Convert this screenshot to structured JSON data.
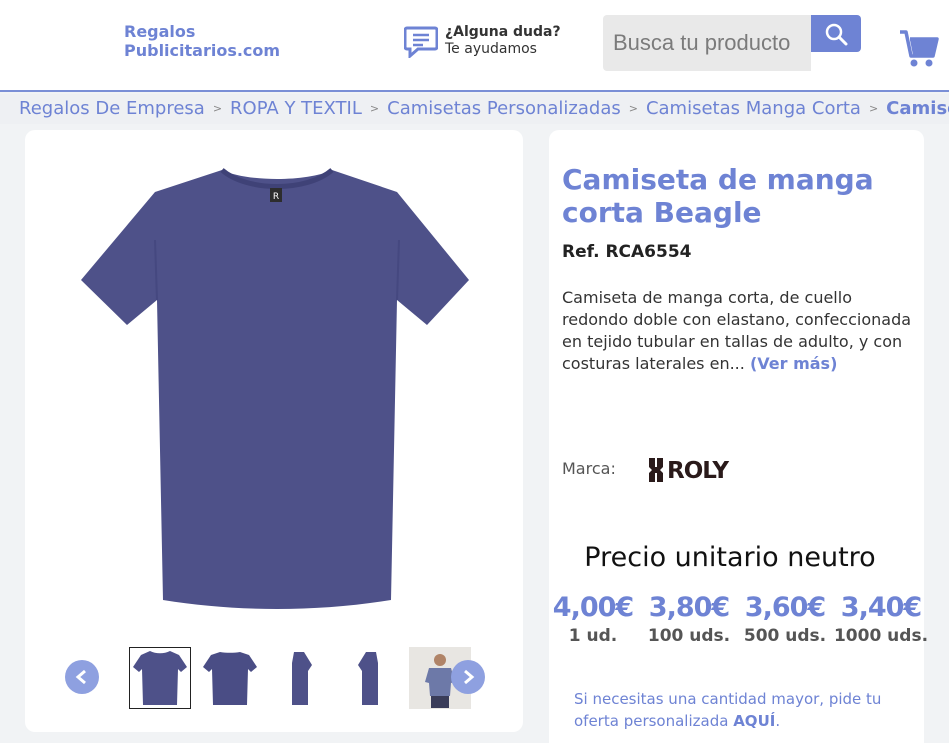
{
  "header": {
    "logo_line1": "Regalos",
    "logo_line2": "Publicitarios.com",
    "help_question": "¿Alguna duda?",
    "help_text": "Te ayudamos",
    "search_placeholder": "Busca tu producto"
  },
  "breadcrumb": [
    "Regalos De Empresa",
    "ROPA Y TEXTIL",
    "Camisetas Personalizadas",
    "Camisetas Manga Corta",
    "Camiseta de manga corta Beagle"
  ],
  "product": {
    "title": "Camiseta de manga corta Beagle",
    "ref": "Ref. RCA6554",
    "description": "Camiseta de manga corta, de cuello redondo doble con elastano, confeccionada en tejido tubular en tallas de adulto, y con costuras laterales en...",
    "more_link": "(Ver más)",
    "brand_label": "Marca:",
    "brand_name": "ROLY",
    "color": "#4e5189"
  },
  "pricing": {
    "title": "Precio unitario neutro",
    "tiers": [
      {
        "price": "4,00€",
        "qty": "1 ud."
      },
      {
        "price": "3,80€",
        "qty": "100 uds."
      },
      {
        "price": "3,60€",
        "qty": "500 uds."
      },
      {
        "price": "3,40€",
        "qty": "1000 uds."
      }
    ],
    "note": "Si necesitas una cantidad mayor, pide tu oferta personalizada",
    "note_link": "AQUÍ",
    "note_end": "."
  },
  "gallery": {
    "thumbs": [
      "front-view",
      "back-view",
      "side-view-left",
      "side-view-right",
      "model-view"
    ],
    "selected": 0
  },
  "colors": {
    "accent": "#6e83d4"
  }
}
